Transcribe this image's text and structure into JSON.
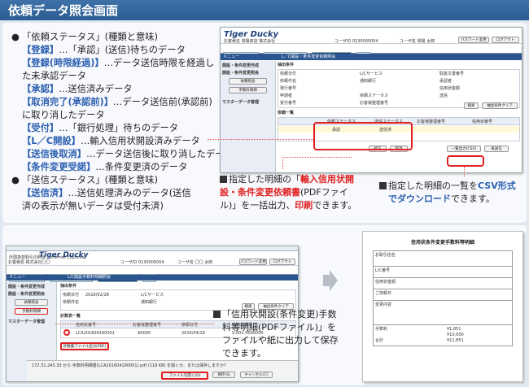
{
  "title": "依頼データ照会画面",
  "status_section": {
    "header": "「依頼ステータス」(種類と意味)",
    "items": [
      {
        "term": "【登録】",
        "desc": "…「承認」(送信)待ちのデータ"
      },
      {
        "term": "【登録(時限経過)】",
        "desc": "…データ送信時限を経過し"
      },
      {
        "term": "",
        "desc": "た未承認データ"
      },
      {
        "term": "【承認】",
        "desc": "…送信済みデータ"
      },
      {
        "term": "【取消完了(承認前)】",
        "desc": "…データ送信前(承認前)"
      },
      {
        "term": "",
        "desc": "に取り消したデータ"
      },
      {
        "term": "【受付】",
        "desc": "…「銀行処理」待ちのデータ"
      },
      {
        "term": "【L／C開設】",
        "desc": "…輸入信用状開設済みデータ"
      },
      {
        "term": "【送信後取消】",
        "desc": "…データ送信後に取り消したデータ"
      },
      {
        "term": "【条件変更受諾】",
        "desc": "…条件変更済のデータ"
      }
    ]
  },
  "send_section": {
    "header": "「送信ステータス」(種類と意味)",
    "items": [
      {
        "term": "【送信済】",
        "desc": "…送信処理済みのデータ(送信"
      },
      {
        "term": "",
        "desc": "済の表示が無いデータは受付未済)"
      }
    ]
  },
  "callouts": {
    "pdf_print_pre": "指定した明細の「",
    "pdf_print_red1": "輸入信用状開",
    "pdf_print_red2": "設・条件変更依頼書",
    "pdf_print_mid": "(PDFファイ",
    "pdf_print_line3a": "ル)」を一括出力、",
    "pdf_print_red3": "印刷",
    "pdf_print_end": "できます。",
    "csv_pre": "指定した明細の一覧を",
    "csv_blue1": "CSV形式",
    "csv_blue2": "でダウンロード",
    "csv_end": "できます。",
    "fee_line1": "「信用状開設(条件変更)手数",
    "fee_line2": "料等明細(PDFファイル)」を",
    "fee_line3": "ファイルや紙に出力して保存",
    "fee_line4": "できます。"
  },
  "top_screen": {
    "logo": "Tiger Ducky",
    "customer": "お客様名 常陽商店 株式会社",
    "user_id": "ユーザID 0130000004",
    "user_name": "ユーザ名 常陽 太郎",
    "password_btn": "パスワード変更",
    "logout_btn": "ログアウト",
    "tabs": [
      "各種手続サービス",
      "外国送金依頼サービス",
      "輸入信用状サービス",
      "外運"
    ],
    "menu": "メニュー",
    "page_title": "L／C開設・条件変更依頼照会",
    "side_items": [
      "開設・条件変更作成",
      "開設・条件変更照会",
      "依頼照会",
      "手数料明細",
      "マスターデータ管理"
    ],
    "cond_title": "抽出条件",
    "labels": [
      "依頼日付",
      "L/Cサービス",
      "取扱文書番号",
      "依頼件名",
      "通知銀行",
      "承認者",
      "発行番号",
      "信用状金額",
      "申請者",
      "依頼ステータス",
      "送信",
      "受付番号",
      "お客様整理番号"
    ],
    "search_btn": "検索",
    "clear_btn": "抽出条件クリア",
    "list_title": "依頼一覧",
    "columns": [
      "依頼ステータス",
      "送信ステータス",
      "お客様整理番号",
      "信用状番号"
    ],
    "row": [
      "承認",
      "送信済"
    ],
    "btn_back": "修正",
    "btn_cancel": "取消",
    "btn_csv": "一覧出力(CSV)",
    "btn_print": "再送信"
  },
  "bottom_screen": {
    "ie_title": "外国為替取引の照会 - Internet Explorer",
    "customer": "お客様名 株式会社〇〇",
    "user_id": "ユーザID 0130000004",
    "user_name": "ユーザ名 〇〇 太郎",
    "tabs": [
      "各種手続サービス",
      "外国送金依頼サービス",
      "輸入信用状サービス",
      "外運"
    ],
    "page_title": "L/C開設手数料明細照会",
    "side_items": [
      "開設・条件変更作成",
      "開設・条件変更照会",
      "依頼照会",
      "手数料明細"
    ],
    "side_master": "マスターデータ管理",
    "date_value": "2016/02/28",
    "list_title": "計数表一覧",
    "columns": [
      "信用状番号",
      "お客様整理番号",
      "依頼日付",
      "信用状番号"
    ],
    "row": [
      "LCA201604190001",
      "A0000",
      "2016/04/19",
      "S-001-0000000"
    ],
    "file_btn": "計数書ファイル出力(PDF)",
    "download_text": "172.31.245.33 から 手数料明細書(LCA201604190001).pdf (118 KB) を開くか、または保存しますか?",
    "open_btn": "ファイルを開く(O)",
    "save_btn": "保存(S)",
    "cancel_btn": "キャンセル(C)"
  },
  "doc": {
    "title": "信用状条件変更手数料等明細",
    "rows": [
      "お取引店名",
      "L/C番号",
      "信用状金額",
      "ご依頼日",
      "変更内容",
      "手数料",
      "合計"
    ],
    "amounts": [
      "¥1,851",
      "¥10,000",
      "¥11,851"
    ]
  }
}
